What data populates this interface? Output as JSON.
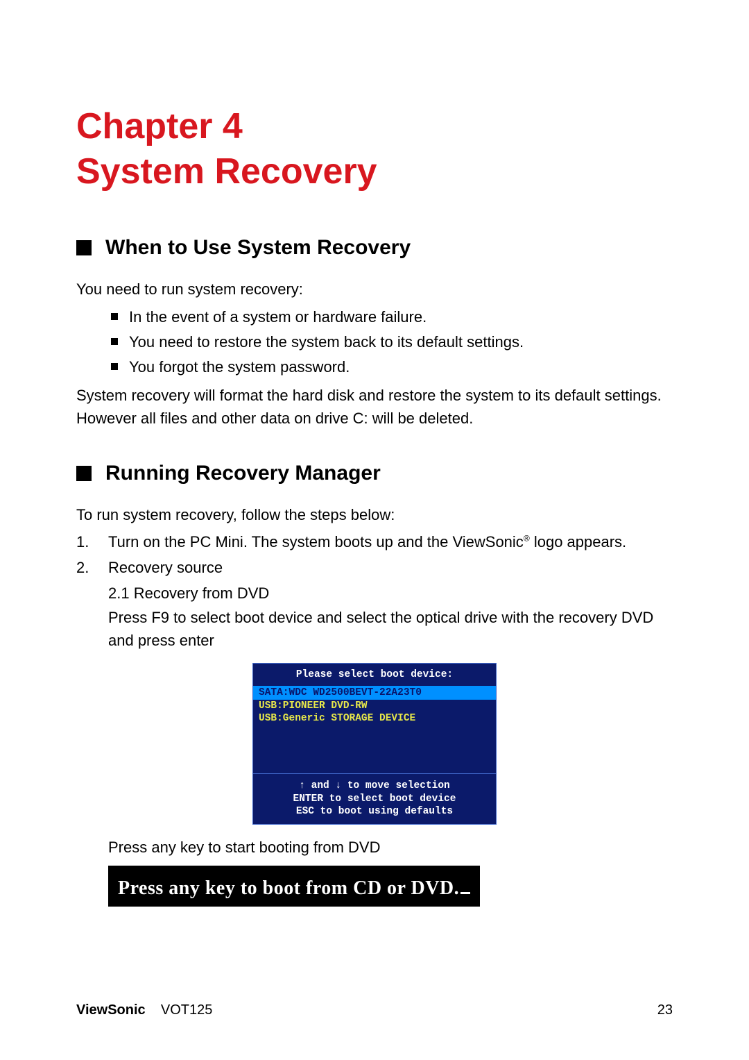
{
  "chapter": {
    "line1": "Chapter 4",
    "line2": "System Recovery"
  },
  "section1": {
    "title": "When to Use System Recovery",
    "intro": "You need to run system recovery:",
    "bullets": [
      "In the event of a system or hardware failure.",
      "You need to restore the system back to its default settings.",
      "You forgot the system password."
    ],
    "outro": "System recovery will format the hard disk and restore the system to its default settings. However all files and other data on drive C: will be deleted."
  },
  "section2": {
    "title": "Running Recovery Manager",
    "intro": "To run system recovery, follow the steps below:",
    "step1": {
      "num": "1.",
      "text_pre": "Turn on the PC Mini. The system boots up and the ViewSonic",
      "reg": "®",
      "text_post": " logo appears."
    },
    "step2": {
      "num": "2.",
      "text": "Recovery source",
      "sub_label": "2.1 Recovery from DVD",
      "sub_text": "Press F9 to select boot device and select the optical drive with the recovery DVD and press enter",
      "after_shot": "Press any key to start booting from DVD"
    }
  },
  "bios": {
    "title": "Please select boot device:",
    "selected": "SATA:WDC WD2500BEVT-22A23T0",
    "line2": "USB:PIONEER DVD-RW",
    "line3": "USB:Generic STORAGE DEVICE",
    "footer1": "↑ and ↓ to move selection",
    "footer2": "ENTER to select boot device",
    "footer3": "ESC to boot using defaults"
  },
  "boot_banner": "Press any key to boot from CD or DVD.",
  "footer": {
    "brand": "ViewSonic",
    "model": "VOT125",
    "page": "23"
  }
}
